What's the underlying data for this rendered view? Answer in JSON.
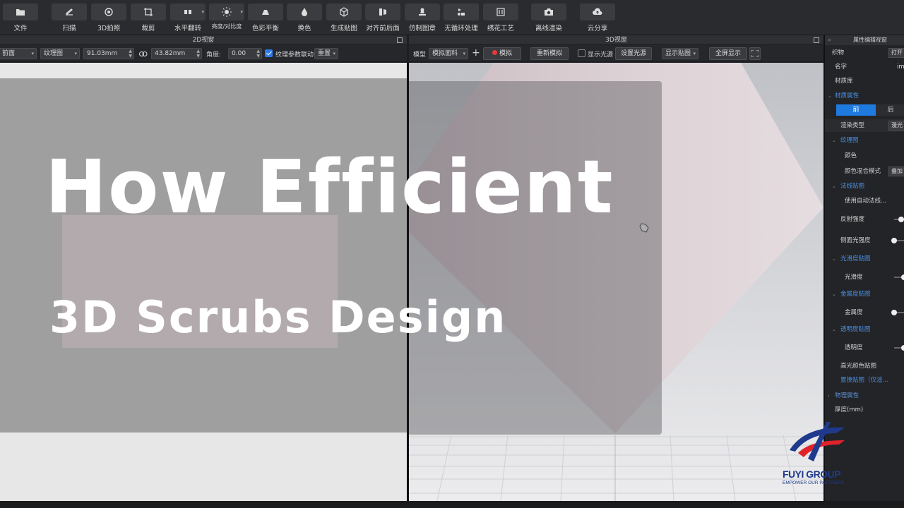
{
  "toolbar": {
    "items": [
      {
        "label": "文件",
        "icon": "folder-icon"
      },
      {
        "label": "扫描",
        "icon": "scan-icon"
      },
      {
        "label": "3D拍照",
        "icon": "camera-aperture-icon"
      },
      {
        "label": "裁剪",
        "icon": "crop-icon"
      },
      {
        "label": "水平翻转",
        "icon": "flip-horizontal-icon"
      },
      {
        "label": "亮度/对比度",
        "icon": "brightness-icon"
      },
      {
        "label": "色彩平衡",
        "icon": "color-balance-icon"
      },
      {
        "label": "换色",
        "icon": "color-drop-icon"
      },
      {
        "label": "生成贴图",
        "icon": "cube-icon"
      },
      {
        "label": "对齐前后面",
        "icon": "align-icon"
      },
      {
        "label": "仿制图章",
        "icon": "stamp-icon"
      },
      {
        "label": "无循环处理",
        "icon": "seamless-icon"
      },
      {
        "label": "绣花工艺",
        "icon": "embroidery-icon"
      },
      {
        "label": "离线渲染",
        "icon": "render-camera-icon"
      },
      {
        "label": "云分享",
        "icon": "cloud-upload-icon"
      }
    ]
  },
  "view2d": {
    "title": "2D视窗",
    "side_select": "前面",
    "layer_select": "纹理图",
    "width_value": "91.03mm",
    "height_value": "43.82mm",
    "angle_label": "角度:",
    "angle_value": "0.00",
    "link_label": "纹理参数联动",
    "link_checked": true,
    "reset_label": "重置"
  },
  "view3d": {
    "title": "3D视窗",
    "model_label": "模型",
    "model_select": "模拟面料",
    "simulate_label": "模拟",
    "resimulate_label": "重新模拟",
    "show_light_label": "显示光源",
    "show_light_checked": false,
    "set_light_label": "设置光源",
    "show_map_select": "显示贴图",
    "fullscreen_label": "全屏显示"
  },
  "properties": {
    "title": "属性编辑视窗",
    "fabric_label": "织物",
    "open_button": "打开",
    "name_label": "名字",
    "name_value": "img",
    "library_label": "材质库",
    "material_section": "材质属性",
    "tab_front": "前",
    "tab_back": "后",
    "render_type_label": "渲染类型",
    "render_type_value": "漫光",
    "texture_section": "纹理图",
    "color_label": "颜色",
    "blend_mode_label": "颜色混合模式",
    "blend_mode_value": "叠加",
    "normal_section": "法线贴图",
    "auto_normal_label": "使用自动法线...",
    "reflect_label": "反射强度",
    "reflect_level": 0.6,
    "side_light_label": "侧面光强度",
    "side_light_level": 0.0,
    "gloss_section": "光滑度贴图",
    "gloss_label": "光滑度",
    "gloss_level": 0.9,
    "metal_section": "金属度贴图",
    "metal_label": "金属度",
    "metal_level": 0.0,
    "opacity_section": "透明度贴图",
    "opacity_label": "透明度",
    "opacity_level": 0.9,
    "highlight_map_label": "高光颜色贴图",
    "replace_map_label": "置换贴图（仅渲...",
    "physics_section": "物理属性",
    "thickness_label": "厚度(mm)"
  },
  "overlay": {
    "headline": "How Efficient",
    "subhead": "3D Scrubs Design"
  },
  "logo": {
    "name": "FUYI GROUP",
    "slogan": "EMPOWER OUR PARTNERS"
  },
  "colors": {
    "accent_blue": "#2d7be8",
    "section_blue": "#4a90e2",
    "fabric_pink": "#d9cdd1",
    "simulate_red": "#e23b3b",
    "logo_blue": "#1f3a8c",
    "logo_red": "#e0232b"
  }
}
